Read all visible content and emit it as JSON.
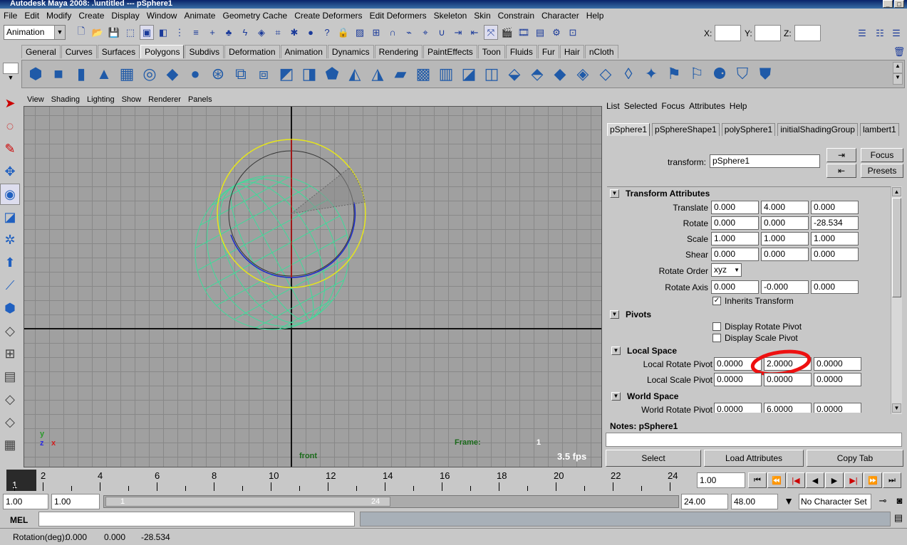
{
  "window": {
    "title": "Autodesk Maya 2008: .\\untitled   ---   pSphere1"
  },
  "menubar": [
    "File",
    "Edit",
    "Modify",
    "Create",
    "Display",
    "Window",
    "Animate",
    "Geometry Cache",
    "Create Deformers",
    "Edit Deformers",
    "Skeleton",
    "Skin",
    "Constrain",
    "Character",
    "Help"
  ],
  "statusline": {
    "mode": "Animation",
    "x_label": "X:",
    "y_label": "Y:",
    "z_label": "Z:"
  },
  "shelf_tabs": [
    "General",
    "Curves",
    "Surfaces",
    "Polygons",
    "Subdivs",
    "Deformation",
    "Animation",
    "Dynamics",
    "Rendering",
    "PaintEffects",
    "Toon",
    "Fluids",
    "Fur",
    "Hair",
    "nCloth"
  ],
  "shelf_active": "Polygons",
  "panel_menu": [
    "View",
    "Shading",
    "Lighting",
    "Show",
    "Renderer",
    "Panels"
  ],
  "viewport": {
    "camera": "front",
    "frame_label": "Frame:",
    "frame_value": "1",
    "fps": "3.5 fps",
    "axis_y": "y",
    "axis_z": "z",
    "axis_x": "x"
  },
  "attr_editor": {
    "menu": [
      "List",
      "Selected",
      "Focus",
      "Attributes",
      "Help"
    ],
    "tabs": [
      "pSphere1",
      "pSphereShape1",
      "polySphere1",
      "initialShadingGroup",
      "lambert1"
    ],
    "active_tab": "pSphere1",
    "node_type_label": "transform:",
    "node_name": "pSphere1",
    "focus_btn": "Focus",
    "presets_btn": "Presets",
    "sections": {
      "transform": "Transform Attributes",
      "pivots": "Pivots",
      "local_space": "Local Space",
      "world_space": "World Space"
    },
    "translate": {
      "label": "Translate",
      "x": "0.000",
      "y": "4.000",
      "z": "0.000"
    },
    "rotate": {
      "label": "Rotate",
      "x": "0.000",
      "y": "0.000",
      "z": "-28.534"
    },
    "scale": {
      "label": "Scale",
      "x": "1.000",
      "y": "1.000",
      "z": "1.000"
    },
    "shear": {
      "label": "Shear",
      "x": "0.000",
      "y": "0.000",
      "z": "0.000"
    },
    "rotate_order": {
      "label": "Rotate Order",
      "value": "xyz"
    },
    "rotate_axis": {
      "label": "Rotate Axis",
      "x": "0.000",
      "y": "-0.000",
      "z": "0.000"
    },
    "inherits_transform": "Inherits Transform",
    "display_rotate_pivot": "Display Rotate Pivot",
    "display_scale_pivot": "Display Scale Pivot",
    "local_rotate_pivot": {
      "label": "Local Rotate Pivot",
      "x": "0.0000",
      "y": "2.0000",
      "z": "0.0000"
    },
    "local_scale_pivot": {
      "label": "Local Scale Pivot",
      "x": "0.0000",
      "y": "0.0000",
      "z": "0.0000"
    },
    "world_rotate_pivot": {
      "label": "World Rotate Pivot",
      "x": "0.0000",
      "y": "6.0000",
      "z": "0.0000"
    },
    "notes_label": "Notes:  pSphere1",
    "select_btn": "Select",
    "load_attributes_btn": "Load Attributes",
    "copy_tab_btn": "Copy Tab"
  },
  "timeline": {
    "current": "1",
    "labels": [
      "2",
      "4",
      "6",
      "8",
      "10",
      "12",
      "14",
      "16",
      "18",
      "20",
      "22",
      "24"
    ],
    "current_time": "1.00"
  },
  "range": {
    "start": "1.00",
    "playback_start": "1.00",
    "slider_start": "1",
    "slider_end": "24",
    "playback_end": "24.00",
    "end": "48.00",
    "character_set": "No Character Set"
  },
  "command_line": {
    "label": "MEL"
  },
  "help_line": {
    "label": "Rotation(deg):",
    "x": "0.000",
    "y": "0.000",
    "z": "-28.534"
  }
}
